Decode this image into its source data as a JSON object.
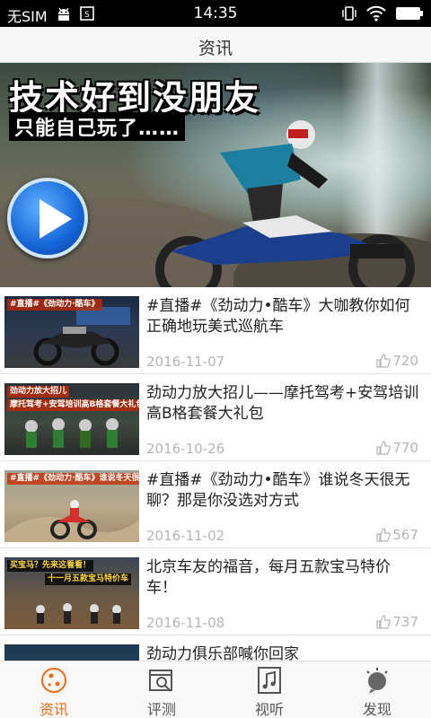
{
  "status_bar": {
    "carrier": "无SIM",
    "time": "14:35",
    "icons": [
      "android-icon",
      "screenshot-icon",
      "vibrate-icon",
      "wifi-icon",
      "battery-icon"
    ]
  },
  "header": {
    "title": "资讯"
  },
  "banner": {
    "headline": "技术好到没朋友",
    "subline": "只能自己玩了……",
    "slide_count": 6,
    "active_slide": 4,
    "play_icon": "play-icon",
    "accent_color": "#1e6fe0"
  },
  "news": [
    {
      "thumb_caption": "#直播#《劲动力·酷车》",
      "title": "#直播#《劲动力•酷车》大咖教你如何正确地玩美式巡航车",
      "date": "2016-11-07",
      "likes": "720"
    },
    {
      "thumb_caption": "劲动力放大招儿",
      "thumb_caption2": "摩托驾考+安驾培训高B格套餐大礼包",
      "title": "劲动力放大招儿——摩托驾考+安驾培训高B格套餐大礼包",
      "date": "2016-10-26",
      "likes": "770"
    },
    {
      "thumb_caption": "#直播#《劲动力·酷车》谁说冬天很无聊",
      "title": "#直播#《劲动力•酷车》谁说冬天很无聊？那是你没选对方式",
      "date": "2016-11-02",
      "likes": "567"
    },
    {
      "thumb_caption": "买宝马？先来这看看！",
      "thumb_caption2": "十一月五款宝马特价车",
      "title": "北京车友的福音，每月五款宝马特价车！",
      "date": "2016-11-08",
      "likes": "737"
    },
    {
      "title": "劲动力俱乐部喊你回家"
    }
  ],
  "tabs": [
    {
      "label": "资讯",
      "icon": "news-icon",
      "active": true
    },
    {
      "label": "评测",
      "icon": "review-icon",
      "active": false
    },
    {
      "label": "视听",
      "icon": "music-icon",
      "active": false
    },
    {
      "label": "发现",
      "icon": "discover-icon",
      "active": false
    }
  ],
  "colors": {
    "tab_active": "#ef6a12",
    "meta_gray": "#b5b5b5"
  }
}
